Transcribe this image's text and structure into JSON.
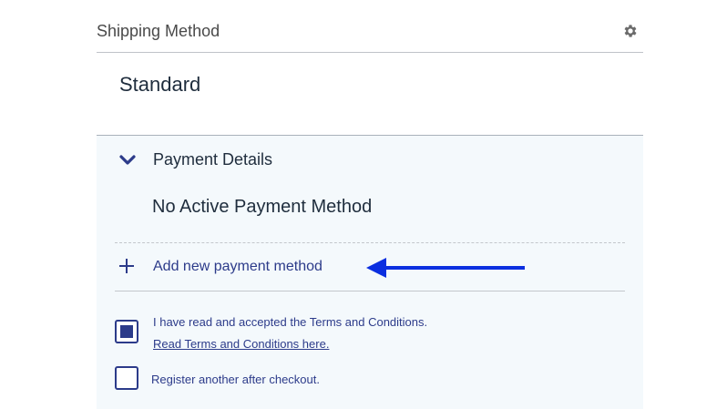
{
  "shipping": {
    "title": "Shipping Method",
    "value": "Standard",
    "settings_icon": "gear-icon"
  },
  "payment": {
    "title": "Payment Details",
    "toggle_icon": "chevron-down-icon",
    "status": "No Active Payment Method",
    "add_label": "Add new payment method",
    "add_icon": "plus-icon"
  },
  "annotation": {
    "arrow_color": "#0b2fe0"
  },
  "terms": {
    "checked": true,
    "text": "I have read and accepted the Terms and Conditions.",
    "link_text": "Read Terms and Conditions here."
  },
  "register": {
    "checked": false,
    "text": "Register another after checkout."
  },
  "colors": {
    "accent": "#2c3b8a",
    "panel_bg": "#f4f9fc"
  }
}
